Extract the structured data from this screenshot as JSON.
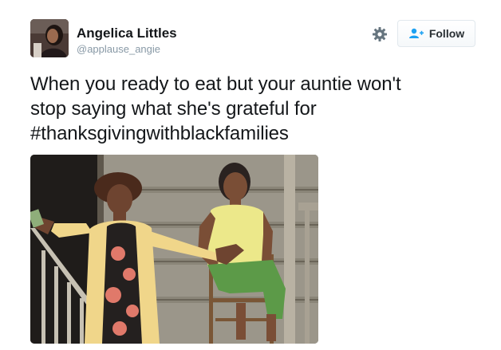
{
  "author": {
    "display_name": "Angelica Littles",
    "screen_name": "@applause_angie"
  },
  "actions": {
    "follow_label": "Follow",
    "settings_icon": "gear-icon",
    "follow_icon": "add-user-icon"
  },
  "tweet": {
    "text_lines": [
      "When you ready to eat but your auntie won't",
      "stop saying what she's grateful for"
    ],
    "hashtag": "#thanksgivingwithblackfamilies"
  },
  "colors": {
    "secondary_text": "#8899a6",
    "primary_text": "#14171a",
    "button_border": "#e1e8ed",
    "follow_icon": "#1da1f2"
  }
}
